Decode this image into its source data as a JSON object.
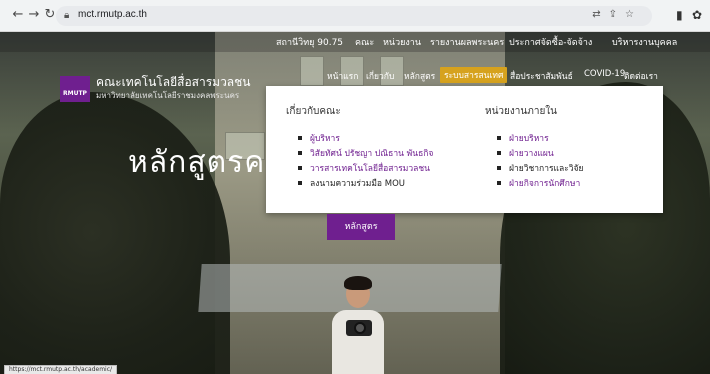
{
  "browser": {
    "url": "mct.rmutp.ac.th",
    "status_url": "https://mct.rmutp.ac.th/academic/"
  },
  "topbar": {
    "items": [
      "สถานีวิทยุ 90.75",
      "คณะ",
      "หน่วยงาน",
      "รายงานผลพระนคร",
      "ประกาศจัดซื้อ-จัดจ้าง",
      "บริหารงานบุคคล"
    ]
  },
  "logo": {
    "badge": "RMUTP",
    "name_th": "คณะเทคโนโลยีสื่อสารมวลชน",
    "university_th": "มหาวิทยาลัยเทคโนโลยีราชมงคลพระนคร"
  },
  "mainnav": {
    "items": [
      "หน้าแรก",
      "เกี่ยวกับ",
      "หลักสูตร",
      "ระบบสารสนเทศ",
      "สื่อประชาสัมพันธ์",
      "COVID-19",
      "ติดต่อเรา"
    ],
    "active_index": 3
  },
  "hero": {
    "title": "หลักสูตรคณ"
  },
  "dropdown": {
    "about": {
      "heading": "เกี่ยวกับคณะ",
      "items": [
        "ผู้บริหาร",
        "วิสัยทัศน์ ปรัชญา ปณิธาน พันธกิจ",
        "วารสารเทคโนโลยีสื่อสารมวลชน",
        "ลงนามความร่วมมือ MOU"
      ]
    },
    "units": {
      "heading": "หน่วยงานภายใน",
      "items": [
        "ฝ่ายบริหาร",
        "ฝ่ายวางแผน",
        "ฝ่ายวิชาการและวิจัย",
        "ฝ่ายกิจการนักศึกษา"
      ]
    }
  },
  "cta": {
    "label": "หลักสูตร"
  },
  "colors": {
    "brand_purple": "#6f1f8f",
    "active_gold": "#d6a21e"
  }
}
